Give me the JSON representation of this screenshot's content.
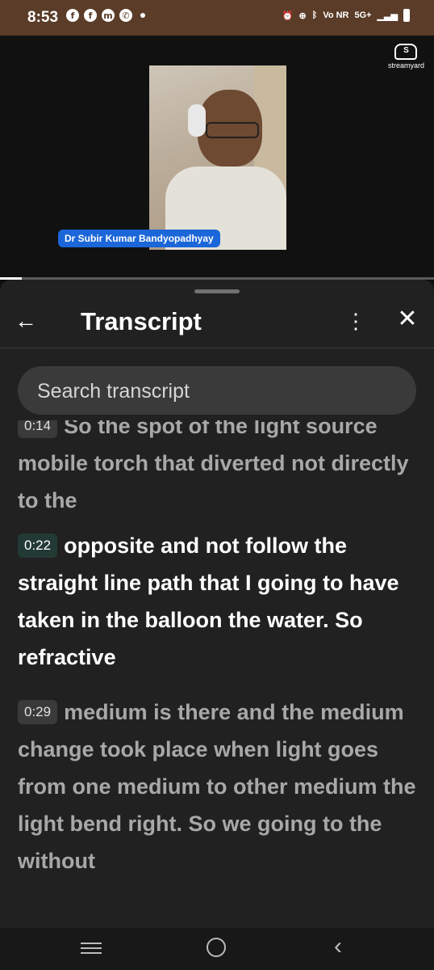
{
  "status_bar": {
    "time": "8:53",
    "left_icons": [
      "facebook-icon",
      "facebook-icon",
      "messenger-icon",
      "whatsapp-icon",
      "dot-icon"
    ],
    "right_icons": [
      "alarm-icon",
      "sync-icon",
      "bluetooth-icon",
      "vo-nr-icon",
      "5g-icon",
      "signal-icon",
      "battery-icon"
    ],
    "network": "5G+",
    "vo_nr": "Vo NR"
  },
  "video": {
    "logo_text": "streamyard",
    "logo_mark": "S",
    "speaker_name": "Dr Subir Kumar Bandyopadhyay",
    "progress_fraction": 0.05
  },
  "panel": {
    "title": "Transcript",
    "search_placeholder": "Search transcript"
  },
  "segments": [
    {
      "time": "0:14",
      "text": "So the spot of the light source mobile torch that diverted not directly to the",
      "active": false
    },
    {
      "time": "0:22",
      "text": "opposite and not follow the straight line path that I going to have taken in the balloon the water. So refractive",
      "active": true
    },
    {
      "time": "0:29",
      "text": "medium is there and the medium change took place when light goes from one medium to other medium the light bend right. So we going to the without",
      "active": false
    }
  ],
  "colors": {
    "status_bar_bg": "#5a3c28",
    "sheet_bg": "#212121",
    "name_badge": "#1b66d8",
    "active_timestamp_bg": "#233a34"
  }
}
